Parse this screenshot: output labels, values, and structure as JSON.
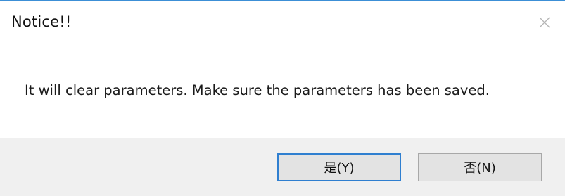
{
  "dialog": {
    "title": "Notice!!",
    "message": "It will clear parameters. Make sure the parameters has been saved.",
    "close_icon": "close-icon",
    "buttons": {
      "yes_label": "是(Y)",
      "no_label": "否(N)"
    },
    "colors": {
      "accent": "#2f7fd0",
      "footer_bg": "#f0f0f0",
      "button_bg": "#e3e3e3"
    }
  }
}
